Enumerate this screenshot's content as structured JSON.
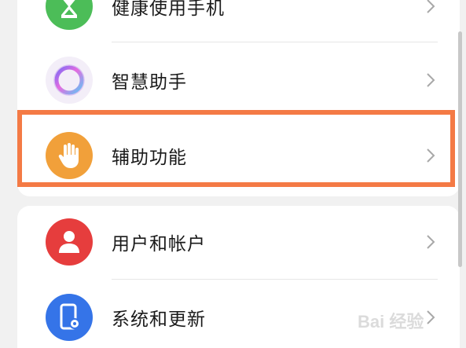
{
  "settings_list": [
    {
      "label": "健康使用手机",
      "icon": "hourglass-icon",
      "color": "#4cbd58"
    },
    {
      "label": "智慧助手",
      "icon": "assistant-ring-icon",
      "color": "#f3eef8"
    },
    {
      "label": "辅助功能",
      "icon": "hand-icon",
      "color": "#f1a03a"
    },
    {
      "label": "用户和帐户",
      "icon": "user-icon",
      "color": "#e63d3d"
    },
    {
      "label": "系统和更新",
      "icon": "phone-gear-icon",
      "color": "#3574e8"
    }
  ],
  "highlight": {
    "color": "#f47a45",
    "target": "辅助功能"
  },
  "watermark": {
    "text": "Bai 经验"
  }
}
